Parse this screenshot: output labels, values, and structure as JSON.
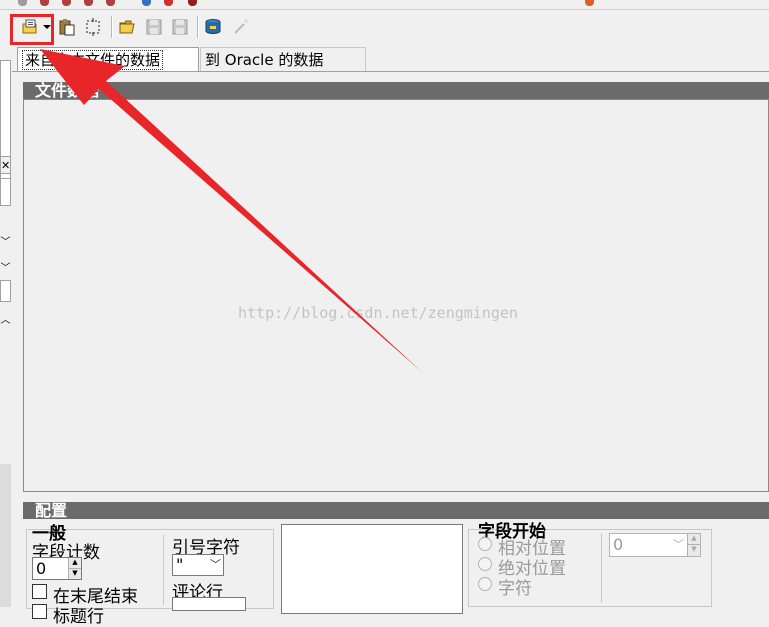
{
  "toolbar": {
    "icons": [
      "open-control-file-icon",
      "dropdown-icon",
      "paste-icon",
      "wizard-icon",
      "open-folder-icon",
      "save-icon",
      "save-as-icon",
      "database-icon",
      "magic-wand-icon"
    ]
  },
  "tabs": [
    {
      "label": "来自文本文件的数据"
    },
    {
      "label": "到 Oracle 的数据"
    }
  ],
  "panels": {
    "file_data_title": "文件数据",
    "config_title": "配置"
  },
  "watermark": "http://blog.csdn.net/zengmingen",
  "config": {
    "general_title": "一般",
    "field_count_label": "字段计数",
    "field_count_value": "0",
    "end_of_line_label": "在末尾结束",
    "header_label": "标题行",
    "quote_char_label": "引号字符",
    "quote_char_value": "\"",
    "comment_line_label": "评论行",
    "field_start_title": "字段开始",
    "relative_position_label": "相对位置",
    "absolute_position_label": "绝对位置",
    "character_label": "字符",
    "field_start_value": "0"
  },
  "colors": {
    "highlight": "#e8262a",
    "panel_header": "#6b6b6b"
  }
}
